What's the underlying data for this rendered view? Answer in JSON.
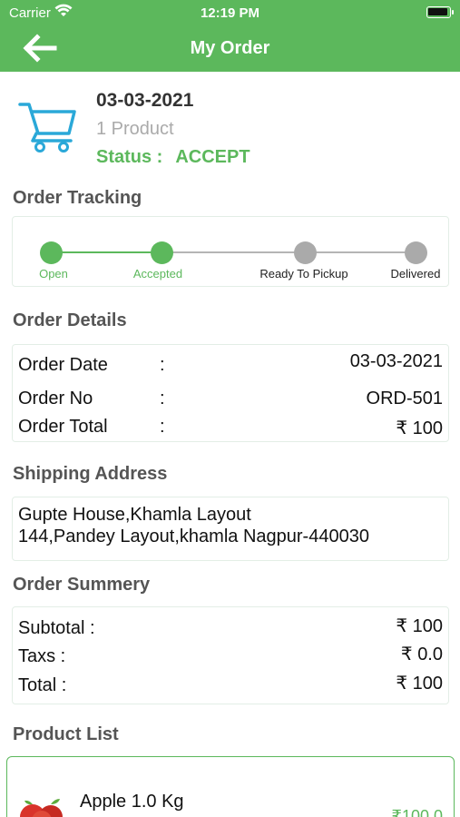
{
  "status_bar": {
    "carrier": "Carrier",
    "time": "12:19 PM"
  },
  "nav": {
    "title": "My Order",
    "back_icon": "arrow-left-icon"
  },
  "order_header": {
    "date": "03-03-2021",
    "product_count": "1 Product",
    "status_label": "Status :",
    "status_value": "ACCEPT",
    "icon": "cart-icon"
  },
  "tracking": {
    "title": "Order Tracking",
    "steps": [
      {
        "label": "Open",
        "done": true
      },
      {
        "label": "Accepted",
        "done": true
      },
      {
        "label": "Ready To Pickup",
        "done": false
      },
      {
        "label": "Delivered",
        "done": false
      }
    ],
    "colors": {
      "done": "#5cb85c",
      "pending": "#aaaaaa"
    }
  },
  "order_details": {
    "title": "Order Details",
    "rows": [
      {
        "label": "Order Date",
        "colon": ":",
        "value": "03-03-2021"
      },
      {
        "label": "Order No",
        "colon": ":",
        "value": "ORD-501"
      },
      {
        "label": "Order Total",
        "colon": ":",
        "value": "₹ 100"
      }
    ]
  },
  "shipping": {
    "title": "Shipping Address",
    "lines": [
      "Gupte House,Khamla Layout",
      "144,Pandey Layout,khamla Nagpur-440030"
    ]
  },
  "summary": {
    "title": "Order Summery",
    "rows": [
      {
        "label": "Subtotal :",
        "value": "₹ 100"
      },
      {
        "label": "Taxs :",
        "value": "₹ 0.0"
      },
      {
        "label": "Total :",
        "value": "₹ 100"
      }
    ]
  },
  "products": {
    "title": "Product List",
    "items": [
      {
        "name": "Apple 1.0 Kg",
        "price": "₹100.0",
        "icon": "apple-icon"
      }
    ]
  },
  "colors": {
    "accent": "#5cb85c",
    "muted": "#aaaaaa"
  }
}
